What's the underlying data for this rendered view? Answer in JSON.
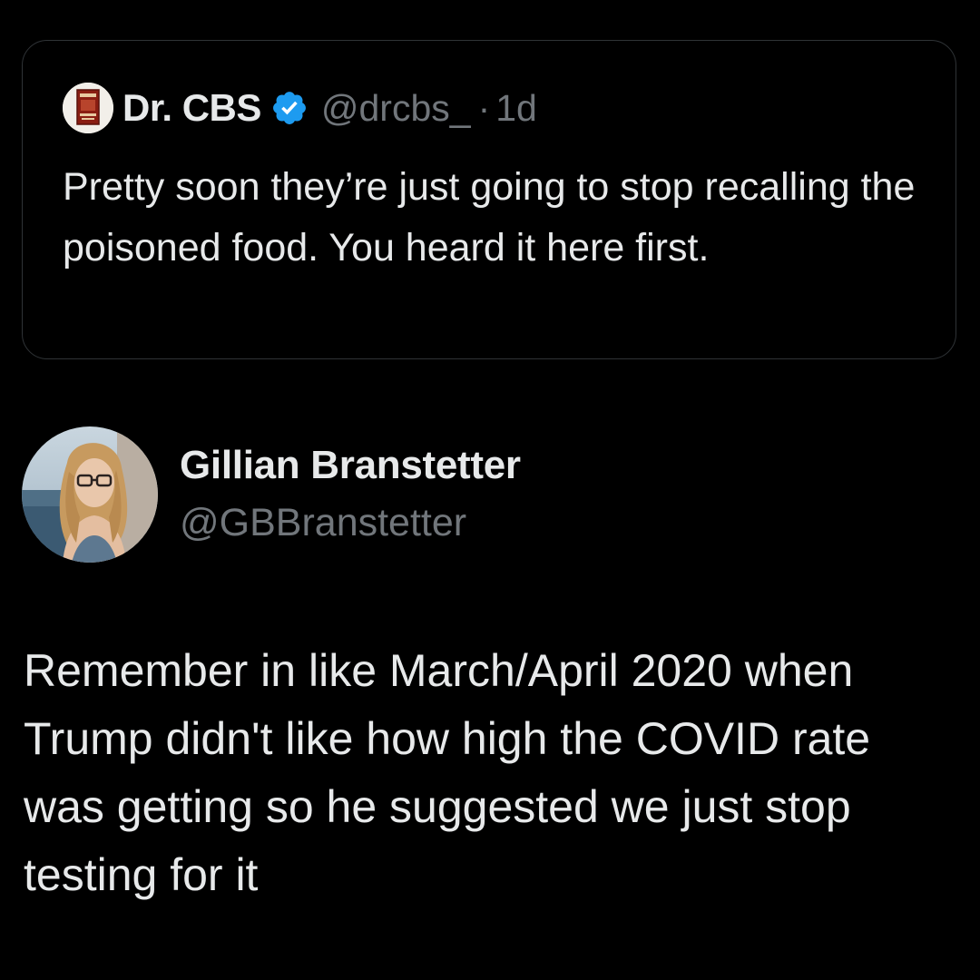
{
  "quoted_tweet": {
    "author_name": "Dr. CBS",
    "author_handle": "@drcbs_",
    "separator": "·",
    "timestamp": "1d",
    "verified": true,
    "avatar_icon": "book-cover-avatar",
    "text": "Pretty soon they’re just going to stop recalling the poisoned food. You heard it here first."
  },
  "tweet": {
    "author_name": "Gillian Branstetter",
    "author_handle": "@GBBranstetter",
    "avatar_icon": "profile-photo-avatar",
    "text": "Remember in like March/April 2020 when Trump didn't like how high the COVID rate was getting so he suggested we just stop testing for it"
  },
  "colors": {
    "background": "#000000",
    "primary_text": "#e7e9ea",
    "secondary_text": "#71767b",
    "border": "#2f3336",
    "verified_blue": "#1d9bf0"
  }
}
